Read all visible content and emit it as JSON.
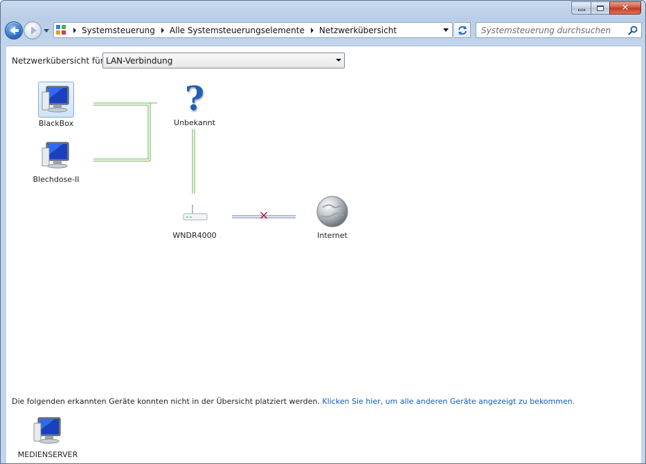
{
  "window": {
    "caption_buttons": {
      "minimize_icon": "minimize-icon",
      "maximize_icon": "maximize-icon",
      "close_icon": "close-icon",
      "close_glyph": "✕"
    }
  },
  "navigation": {
    "back_icon": "back-arrow-icon",
    "forward_icon": "forward-arrow-icon",
    "breadcrumbs": [
      {
        "label": "Systemsteuerung"
      },
      {
        "label": "Alle Systemsteuerungselemente"
      },
      {
        "label": "Netzwerkübersicht"
      }
    ],
    "search_placeholder": "Systemsteuerung durchsuchen"
  },
  "main": {
    "filter_label": "Netzwerkübersicht für",
    "selected_connection": "LAN-Verbindung",
    "nodes": {
      "blackbox": "BlackBox",
      "blechdose": "Blechdose-II",
      "unknown": "Unbekannt",
      "router": "WNDR4000",
      "internet": "Internet"
    },
    "broken_link_marker": "×",
    "unplaced_text": "Die folgenden erkannten Geräte konnten nicht in der Übersicht platziert werden.",
    "unplaced_link": "Klicken Sie hier, um alle anderen Geräte angezeigt zu bekommen.",
    "unplaced_devices": [
      {
        "label": "MEDIENSERVER"
      }
    ]
  },
  "colors": {
    "link_line": "#6ab04c",
    "internet_line": "#5a79a8",
    "broken_marker": "#c0143c",
    "link_text": "#0a5bc4"
  }
}
